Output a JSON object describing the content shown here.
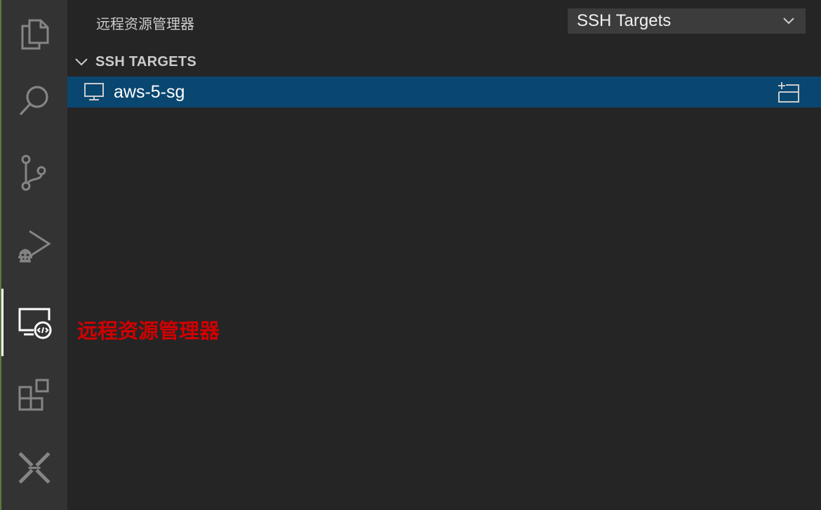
{
  "sidebar": {
    "title": "远程资源管理器",
    "view_select": {
      "value": "SSH Targets"
    },
    "section": {
      "title": "SSH TARGETS",
      "items": [
        {
          "label": "aws-5-sg"
        }
      ]
    }
  },
  "annotation": {
    "text": "远程资源管理器"
  },
  "activity_bar": {
    "items": [
      {
        "icon": "files-icon"
      },
      {
        "icon": "search-icon"
      },
      {
        "icon": "source-control-icon"
      },
      {
        "icon": "run-debug-icon"
      },
      {
        "icon": "remote-explorer-icon",
        "active": true
      },
      {
        "icon": "extensions-icon"
      },
      {
        "icon": "tools-icon"
      }
    ]
  },
  "colors": {
    "activity_bar_bg": "#333333",
    "sidebar_bg": "#252526",
    "selection_bg": "#094771",
    "annotation": "#d10000",
    "icon_stroke": "#858585"
  }
}
